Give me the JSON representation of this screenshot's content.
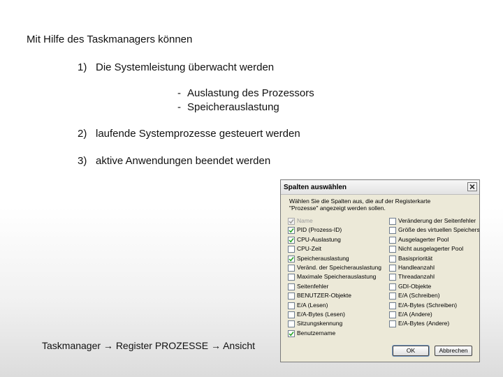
{
  "slide": {
    "intro": "Mit Hilfe des Taskmanagers können",
    "items": [
      {
        "num": "1)",
        "text": "Die Systemleistung überwacht werden"
      },
      {
        "num": "2)",
        "text": "laufende Systemprozesse gesteuert werden"
      },
      {
        "num": "3)",
        "text": "aktive Anwendungen beendet werden"
      }
    ],
    "sub_items": [
      {
        "dash": "-",
        "text": "Auslastung des Prozessors"
      },
      {
        "dash": "-",
        "text": "Speicherauslastung"
      }
    ],
    "caption": "Taskmanager → Register PROZESSE → Ansicht"
  },
  "dialog": {
    "title": "Spalten auswählen",
    "description_line1": "Wählen Sie die Spalten aus, die auf der Registerkarte",
    "description_line2": "\"Prozesse\" angezeigt werden sollen.",
    "left_options": [
      {
        "label": "Name",
        "checked": true,
        "disabled": true
      },
      {
        "label": "PID (Prozess-ID)",
        "checked": true,
        "disabled": false
      },
      {
        "label": "CPU-Auslastung",
        "checked": true,
        "disabled": false
      },
      {
        "label": "CPU-Zeit",
        "checked": false,
        "disabled": false
      },
      {
        "label": "Speicherauslastung",
        "checked": true,
        "disabled": false
      },
      {
        "label": "Veränd. der Speicherauslastung",
        "checked": false,
        "disabled": false
      },
      {
        "label": "Maximale Speicherauslastung",
        "checked": false,
        "disabled": false
      },
      {
        "label": "Seitenfehler",
        "checked": false,
        "disabled": false
      },
      {
        "label": "BENUTZER-Objekte",
        "checked": false,
        "disabled": false
      },
      {
        "label": "E/A (Lesen)",
        "checked": false,
        "disabled": false
      },
      {
        "label": "E/A-Bytes (Lesen)",
        "checked": false,
        "disabled": false
      },
      {
        "label": "Sitzungskennung",
        "checked": false,
        "disabled": false
      },
      {
        "label": "Benutzername",
        "checked": true,
        "disabled": false
      }
    ],
    "right_options": [
      {
        "label": "Veränderung der Seitenfehler",
        "checked": false,
        "disabled": false
      },
      {
        "label": "Größe des virtuellen Speichers",
        "checked": false,
        "disabled": false
      },
      {
        "label": "Ausgelagerter Pool",
        "checked": false,
        "disabled": false
      },
      {
        "label": "Nicht ausgelagerter Pool",
        "checked": false,
        "disabled": false
      },
      {
        "label": "Basispriorität",
        "checked": false,
        "disabled": false
      },
      {
        "label": "Handleanzahl",
        "checked": false,
        "disabled": false
      },
      {
        "label": "Threadanzahl",
        "checked": false,
        "disabled": false
      },
      {
        "label": "GDI-Objekte",
        "checked": false,
        "disabled": false
      },
      {
        "label": "E/A (Schreiben)",
        "checked": false,
        "disabled": false
      },
      {
        "label": "E/A-Bytes (Schreiben)",
        "checked": false,
        "disabled": false
      },
      {
        "label": "E/A (Andere)",
        "checked": false,
        "disabled": false
      },
      {
        "label": "E/A-Bytes (Andere)",
        "checked": false,
        "disabled": false
      }
    ],
    "ok_label": "OK",
    "cancel_label": "Abbrechen"
  }
}
